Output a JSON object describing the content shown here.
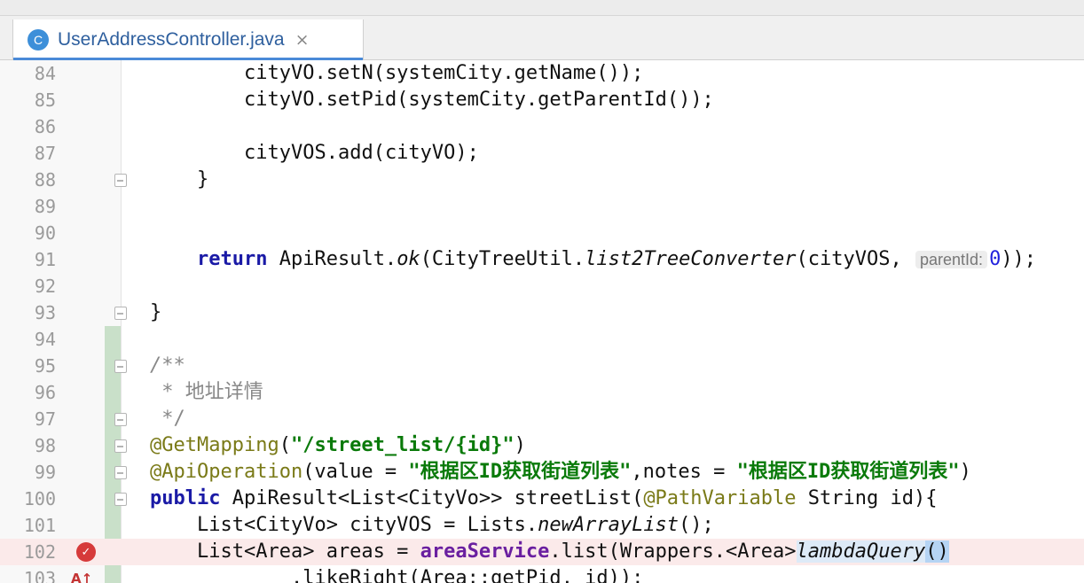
{
  "tab": {
    "icon": "C",
    "label": "UserAddressController.java",
    "close": "×"
  },
  "lines": [
    {
      "num": "84",
      "indent": 4,
      "fold": false,
      "tokens": [
        {
          "t": "cityVO.setN(systemCity.getName());"
        }
      ]
    },
    {
      "num": "85",
      "indent": 4,
      "fold": false,
      "tokens": [
        {
          "t": "cityVO.setPid(systemCity.getParentId());"
        }
      ]
    },
    {
      "num": "86",
      "indent": 0,
      "fold": false,
      "tokens": []
    },
    {
      "num": "87",
      "indent": 4,
      "fold": false,
      "tokens": [
        {
          "t": "cityVOS.add(cityVO);"
        }
      ]
    },
    {
      "num": "88",
      "indent": 2,
      "fold": true,
      "tokens": [
        {
          "t": "}"
        }
      ]
    },
    {
      "num": "89",
      "indent": 0,
      "fold": false,
      "tokens": []
    },
    {
      "num": "90",
      "indent": 0,
      "fold": false,
      "tokens": []
    },
    {
      "num": "91",
      "indent": 2,
      "fold": false,
      "tokens": [
        {
          "t": "return",
          "c": "kw"
        },
        {
          "t": " ApiResult."
        },
        {
          "t": "ok",
          "c": "it"
        },
        {
          "t": "(CityTreeUtil."
        },
        {
          "t": "list2TreeConverter",
          "c": "it"
        },
        {
          "t": "(cityVOS, "
        },
        {
          "t": "parentId:",
          "c": "param"
        },
        {
          "t": "0",
          "c": "num"
        },
        {
          "t": "));"
        }
      ]
    },
    {
      "num": "92",
      "indent": 0,
      "fold": false,
      "tokens": []
    },
    {
      "num": "93",
      "indent": 0,
      "fold": true,
      "tokens": [
        {
          "t": "}"
        }
      ]
    },
    {
      "num": "94",
      "indent": 0,
      "fold": false,
      "tokens": []
    },
    {
      "num": "95",
      "indent": 0,
      "fold": true,
      "tokens": [
        {
          "t": "/**",
          "c": "cmt it"
        }
      ]
    },
    {
      "num": "96",
      "indent": 0,
      "fold": false,
      "tokens": [
        {
          "t": " * ",
          "c": "cmt"
        },
        {
          "t": "地址详情",
          "c": "cmt"
        }
      ]
    },
    {
      "num": "97",
      "indent": 0,
      "fold": true,
      "tokens": [
        {
          "t": " */",
          "c": "cmt"
        }
      ]
    },
    {
      "num": "98",
      "indent": 0,
      "fold": true,
      "tokens": [
        {
          "t": "@GetMapping",
          "c": "ann"
        },
        {
          "t": "("
        },
        {
          "t": "\"/street_list/{id}\"",
          "c": "str"
        },
        {
          "t": ")"
        }
      ]
    },
    {
      "num": "99",
      "indent": 0,
      "fold": true,
      "tokens": [
        {
          "t": "@ApiOperation",
          "c": "ann"
        },
        {
          "t": "(value = "
        },
        {
          "t": "\"根据区ID获取街道列表\"",
          "c": "str"
        },
        {
          "t": ",notes = "
        },
        {
          "t": "\"根据区ID获取街道列表\"",
          "c": "str"
        },
        {
          "t": ")"
        }
      ]
    },
    {
      "num": "100",
      "indent": 0,
      "fold": true,
      "tokens": [
        {
          "t": "public",
          "c": "kw"
        },
        {
          "t": " ApiResult<List<CityVo>> streetList("
        },
        {
          "t": "@PathVariable",
          "c": "ann"
        },
        {
          "t": " String id){"
        }
      ]
    },
    {
      "num": "101",
      "indent": 2,
      "fold": false,
      "tokens": [
        {
          "t": "List<CityVo> cityVOS = Lists."
        },
        {
          "t": "newArrayList",
          "c": "it"
        },
        {
          "t": "();"
        }
      ]
    },
    {
      "num": "102",
      "indent": 2,
      "fold": false,
      "highlight": true,
      "marker": "breakpoint",
      "tokens": [
        {
          "t": "List<Area> areas = "
        },
        {
          "t": "areaService",
          "c": "fld"
        },
        {
          "t": ".list(Wrappers.<Area>"
        },
        {
          "t": "lambdaQuery",
          "c": "lam"
        },
        {
          "t": "()",
          "c": "paren"
        }
      ]
    },
    {
      "num": "103",
      "indent": 6,
      "fold": false,
      "marker": "override",
      "tokens": [
        {
          "t": ".likeRight(Area::getPid, id));"
        }
      ]
    }
  ],
  "icons": {
    "breakpoint": "breakpoint-icon",
    "override": "override-icon",
    "fold": "fold-marker-icon"
  }
}
